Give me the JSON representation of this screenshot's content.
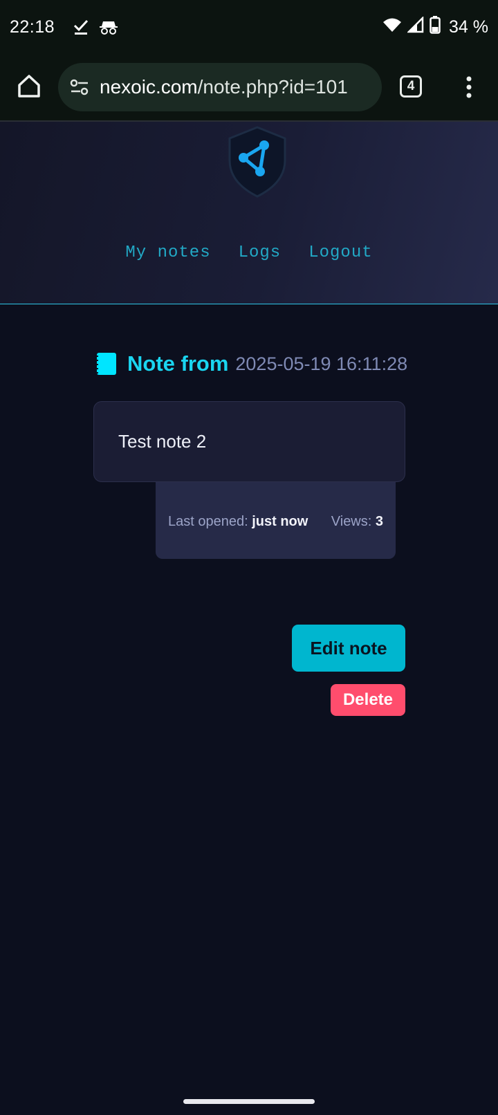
{
  "status_bar": {
    "time": "22:18",
    "battery": "34 %",
    "icons": [
      "checkmark-icon",
      "incognito-icon",
      "wifi-icon",
      "signal-icon",
      "battery-icon"
    ]
  },
  "browser": {
    "url_host": "nexoic.com",
    "url_path": "/note.php?id=101",
    "tab_count": "4"
  },
  "header": {
    "nav": [
      {
        "label": "My notes"
      },
      {
        "label": "Logs"
      },
      {
        "label": "Logout"
      }
    ]
  },
  "note": {
    "heading": "Note from",
    "date": "2025-05-19 16:11:28",
    "content": "Test note 2",
    "last_opened_label": "Last opened:",
    "last_opened_value": "just now",
    "views_label": "Views:",
    "views_value": "3"
  },
  "actions": {
    "edit_label": "Edit note",
    "delete_label": "Delete"
  },
  "colors": {
    "accent": "#00b6cf",
    "danger": "#ff4d6d",
    "background": "#0c0f1e"
  }
}
